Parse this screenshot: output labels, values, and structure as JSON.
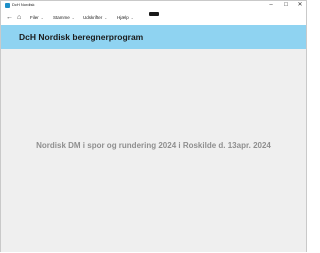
{
  "window": {
    "title": "DcH Nordisk",
    "controls": {
      "minimize": "–",
      "maximize": "☐",
      "close": "✕"
    }
  },
  "menubar": {
    "back_icon": "←",
    "home_icon": "⌂",
    "items": [
      {
        "label": "Filer"
      },
      {
        "label": "Stamme"
      },
      {
        "label": "Udskrifter"
      },
      {
        "label": "Hjælp"
      }
    ]
  },
  "banner": {
    "title": "DcH Nordisk beregnerprogram",
    "color": "#8fd3f1"
  },
  "main": {
    "event_text": "Nordisk DM i spor og rundering 2024  i Roskilde d. 13apr. 2024"
  }
}
